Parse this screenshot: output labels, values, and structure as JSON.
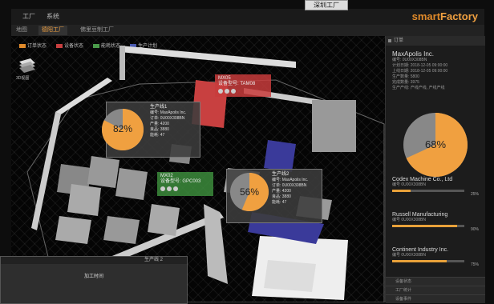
{
  "window": {
    "menu": [
      "工厂",
      "系统"
    ],
    "brand_prefix": "smart",
    "brand_suffix": "Factory",
    "external_label": "深圳工厂"
  },
  "tabs": [
    {
      "label": "地图",
      "active": false
    },
    {
      "label": "德阳工厂",
      "active": true
    },
    {
      "label": "佛里豆制工厂",
      "active": false
    }
  ],
  "legend": [
    {
      "label": "订单状态",
      "color": "#e08a2a"
    },
    {
      "label": "设备状态",
      "color": "#c84040"
    },
    {
      "label": "能耗状态",
      "color": "#4a9a4a"
    },
    {
      "label": "生产计划",
      "color": "#4a5ab0"
    }
  ],
  "tile_label": "3D视图",
  "popups": [
    {
      "title": "生产线1",
      "lines": [
        "编号: MaxApolis Inc.",
        "订单: 0U00X308BN",
        "产量: 4200",
        "良品: 3880",
        "能耗: 47"
      ],
      "percent": "82%",
      "value": 82
    },
    {
      "title": "生产线2",
      "lines": [
        "编号: MaxApolis Inc.",
        "订单: 0U00X308BN",
        "产量: 4200",
        "良品: 3880",
        "能耗: 47"
      ],
      "percent": "56%",
      "value": 56
    }
  ],
  "tags": [
    {
      "title": "MX05",
      "sub": "设备型号: TAM08"
    },
    {
      "title": "MX02",
      "sub": "设备型号: GPC003"
    }
  ],
  "sidebar": {
    "header": "订单",
    "company": "MaxApolis Inc.",
    "details": [
      "编号: 0U00X308BN",
      "计划日期: 2018-12-05 09:00:00",
      "上线日期: 2018-12-05 09:00:00",
      "生产数量: 5800",
      "完成数量: 3975",
      "生产产线: 产线产线, 产线产线"
    ],
    "percent": "68%",
    "value": 68,
    "companies": [
      {
        "name": "Codex Machine Co., Ltd",
        "id": "编号 0U00X308BN",
        "value": 25,
        "pct": "25%"
      },
      {
        "name": "Russell Manufacturing",
        "id": "编号 0U00X308BN",
        "value": 90,
        "pct": "90%"
      },
      {
        "name": "Continent Industry Inc.",
        "id": "编号 0U00X308BN",
        "value": 75,
        "pct": "75%"
      }
    ],
    "footer": [
      "设备状态",
      "工厂统计",
      "设备事件"
    ]
  },
  "overlay": {
    "title": "生产线 2",
    "label": "加工时间"
  }
}
